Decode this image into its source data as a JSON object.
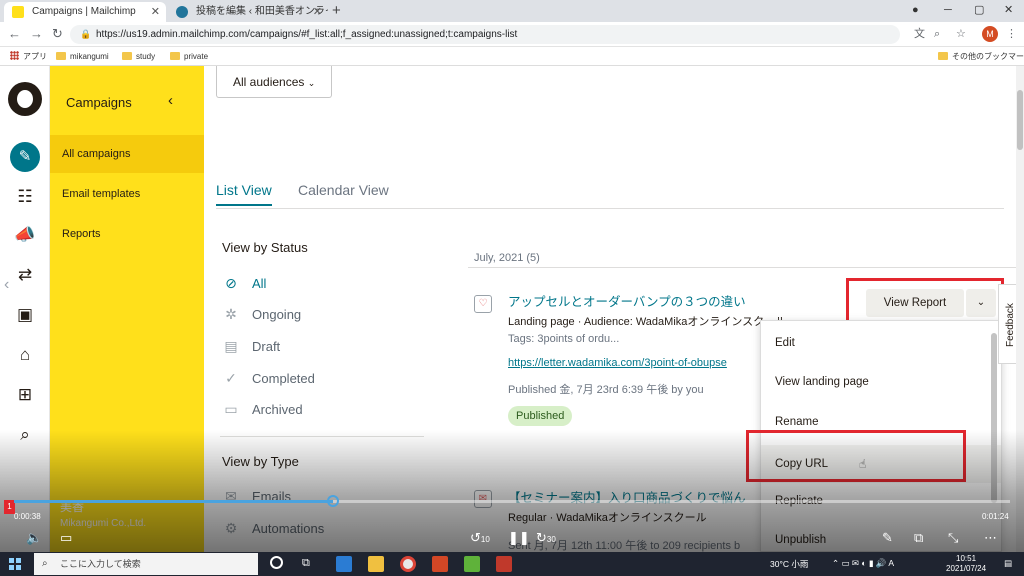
{
  "browser": {
    "tabs": [
      {
        "title": "Campaigns | Mailchimp",
        "active": true
      },
      {
        "title": "投稿を編集 ‹ 和田美香オンラインスク",
        "active": false
      }
    ],
    "url": "https://us19.admin.mailchimp.com/campaigns/#f_list:all;f_assigned:unassigned;t:campaigns-list",
    "profile_initial": "M",
    "bookmarks": [
      "アプリ",
      "mikangumi",
      "study",
      "private"
    ],
    "other_bookmarks": "その他のブックマーク"
  },
  "sidebar": {
    "title": "Campaigns",
    "items": [
      "All campaigns",
      "Email templates",
      "Reports"
    ],
    "user_name": "美香",
    "org": "Mikangumi Co.,Ltd."
  },
  "main": {
    "audience_select": "All audiences",
    "view_tabs": [
      "List View",
      "Calendar View"
    ],
    "status_heading": "View by Status",
    "statuses": [
      "All",
      "Ongoing",
      "Draft",
      "Completed",
      "Archived"
    ],
    "type_heading": "View by Type",
    "types": [
      "Emails",
      "Automations"
    ],
    "group_label": "July, 2021 (5)",
    "campaigns": [
      {
        "title": "アップセルとオーダーバンプの３つの違い",
        "meta": "Landing page · Audience: WadaMikaオンラインスクール",
        "tags": "Tags: 3points of ordu...",
        "link": "https://letter.wadamika.com/3point-of-obupse",
        "published": "Published 金, 7月 23rd 6:39 午後 by you",
        "status": "Published"
      },
      {
        "title": "【セミナー案内】入り口商品づくりで悩ん",
        "meta": "Regular · WadaMikaオンラインスクール",
        "sent": "Sent 月, 7月 12th 11:00 午後 to 209 recipients b"
      }
    ],
    "view_report_label": "View Report",
    "menu": [
      "Edit",
      "View landing page",
      "Rename",
      "Copy URL",
      "Replicate",
      "Unpublish"
    ],
    "feedback_label": "Feedback"
  },
  "video": {
    "chapter": "1",
    "time_current": "0:00:38",
    "time_end": "0:01:24",
    "skip_back": "10",
    "skip_forward": "30",
    "progress": 0.32
  },
  "taskbar": {
    "search_placeholder": "ここに入力して検索",
    "weather": "30°C 小雨",
    "time": "10:51",
    "date": "2021/07/24"
  },
  "colors": {
    "mailchimp_yellow": "#ffe01b",
    "teal": "#00768a",
    "highlight_red": "#e3262e"
  }
}
